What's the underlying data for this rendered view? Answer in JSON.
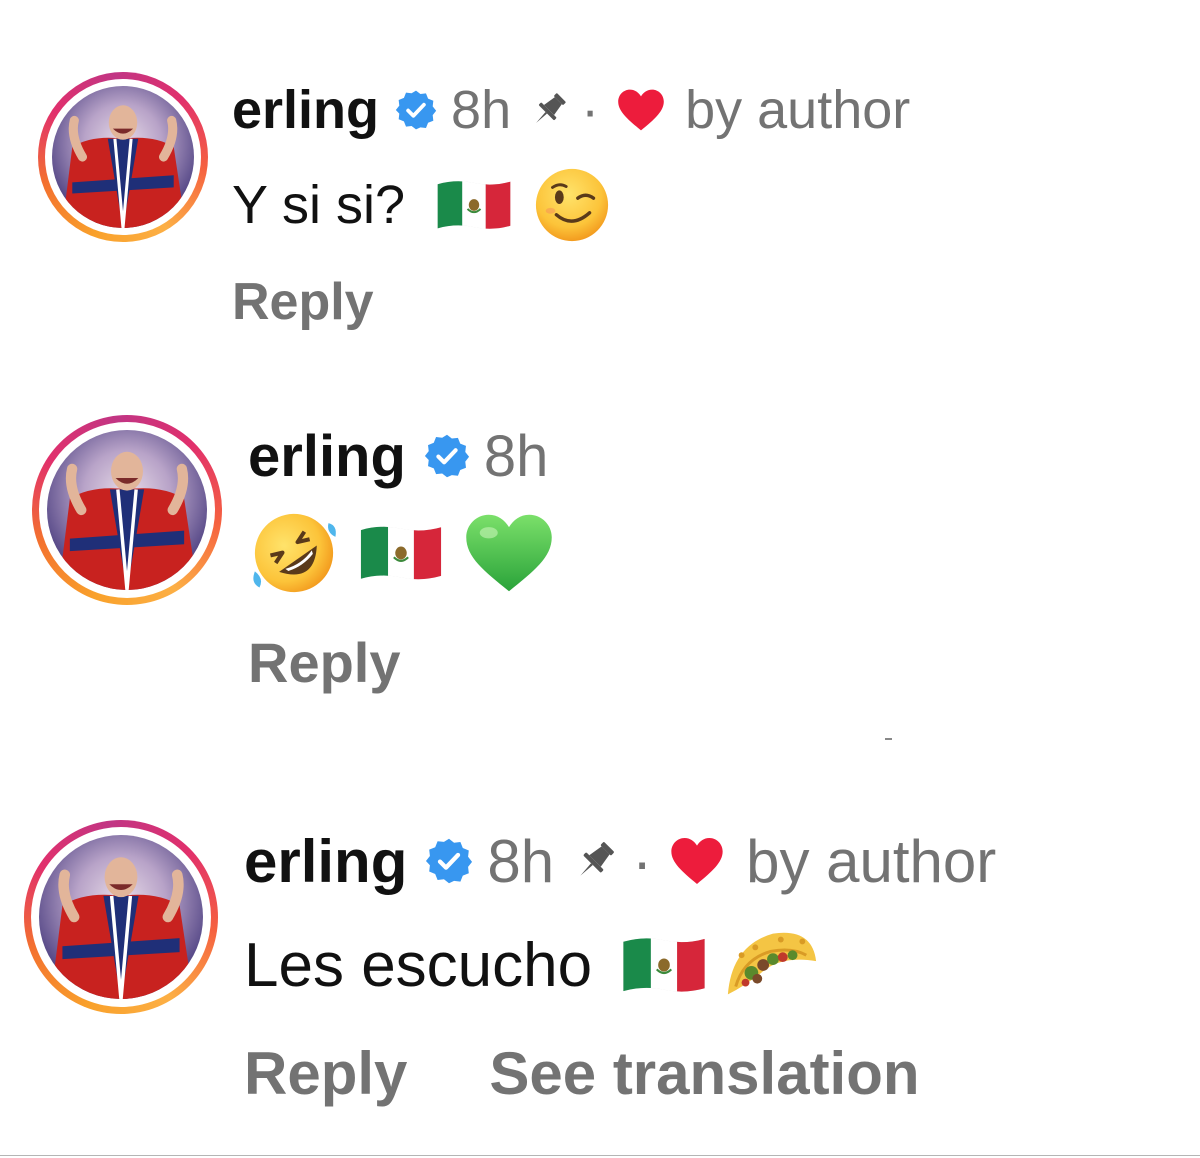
{
  "comments": [
    {
      "username": "erling",
      "time": "8h",
      "pinned": true,
      "dot": "·",
      "liked_by_author_label": "by author",
      "text": "Y si si?",
      "emojis": [
        "mexico-flag",
        "winking-face"
      ],
      "actions": [
        "Reply"
      ]
    },
    {
      "username": "erling",
      "time": "8h",
      "pinned": false,
      "text": "",
      "emojis": [
        "rolling-on-floor-laughing-face",
        "mexico-flag",
        "green-heart"
      ],
      "actions": [
        "Reply"
      ]
    },
    {
      "username": "erling",
      "time": "8h",
      "pinned": true,
      "dot": "·",
      "liked_by_author_label": "by author",
      "text": "Les escucho",
      "emojis": [
        "mexico-flag",
        "taco"
      ],
      "actions": [
        "Reply",
        "See translation"
      ]
    }
  ],
  "colors": {
    "verified_blue": "#3897f0",
    "heart_red": "#ed1c3c",
    "meta_gray": "#737373"
  }
}
